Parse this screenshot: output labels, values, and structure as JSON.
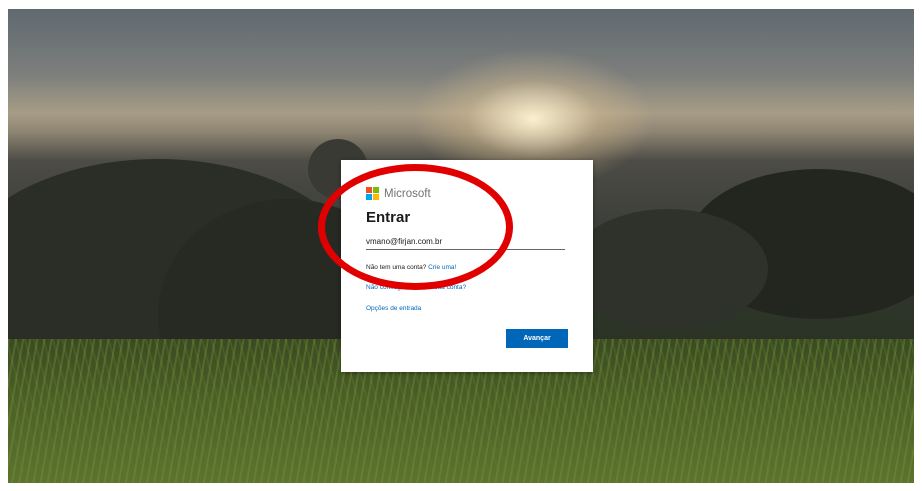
{
  "background": {
    "theme": "rio-sunset-landscape"
  },
  "dialog": {
    "brand_name": "Microsoft",
    "title": "Entrar",
    "email_value": "vmano@firjan.com.br",
    "no_account_text": "Não tem uma conta? ",
    "create_link": "Crie uma!",
    "cant_access_link": "Não consegue acessar sua conta?",
    "options_link": "Opções de entrada",
    "next_button": "Avançar"
  },
  "colors": {
    "accent": "#0067b8",
    "annotation": "#e00000",
    "logo_red": "#f25022",
    "logo_green": "#7fba00",
    "logo_blue": "#00a4ef",
    "logo_yellow": "#ffb900"
  },
  "annotation": {
    "shape": "red-ellipse-highlight"
  }
}
